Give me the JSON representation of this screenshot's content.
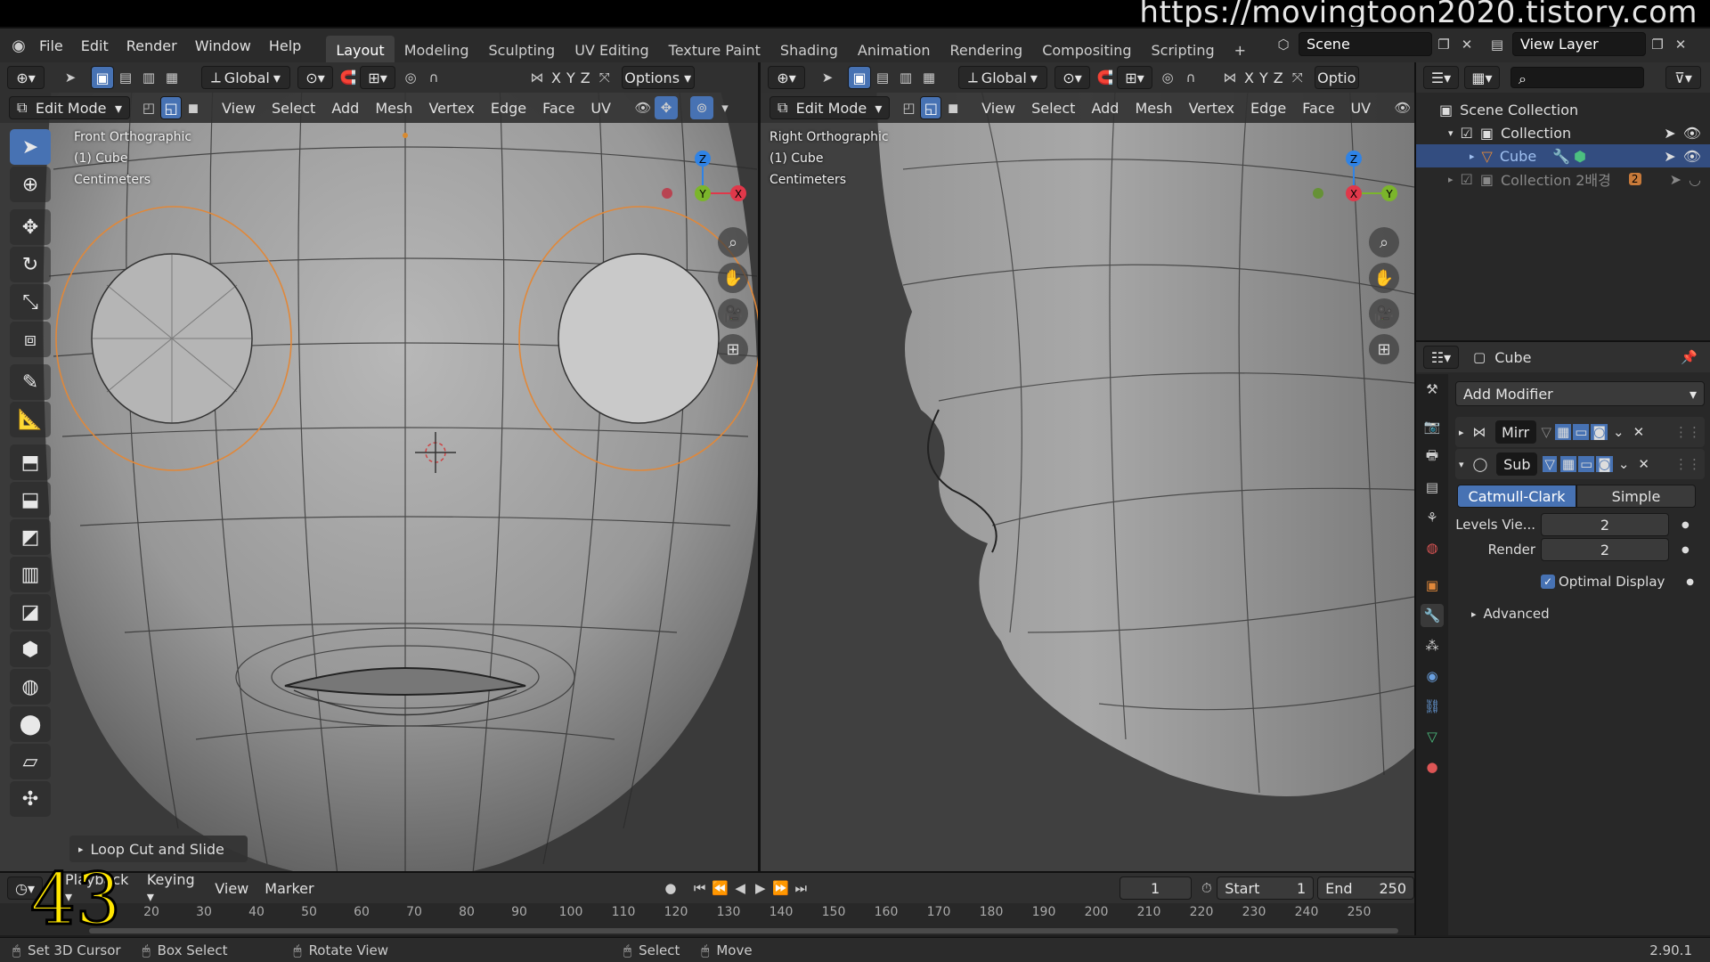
{
  "watermark": "https://movingtoon2020.tistory.com",
  "menu": [
    "File",
    "Edit",
    "Render",
    "Window",
    "Help"
  ],
  "workspaces": [
    "Layout",
    "Modeling",
    "Sculpting",
    "UV Editing",
    "Texture Paint",
    "Shading",
    "Animation",
    "Rendering",
    "Compositing",
    "Scripting"
  ],
  "scene": "Scene",
  "view_layer": "View Layer",
  "left_vp": {
    "orientation": "Global",
    "options": "Options",
    "mode": "Edit Mode",
    "menus": [
      "View",
      "Select",
      "Add",
      "Mesh",
      "Vertex",
      "Edge",
      "Face",
      "UV"
    ],
    "info": [
      "Front Orthographic",
      "(1) Cube",
      "Centimeters"
    ],
    "axes": [
      "Z",
      "Y",
      "X"
    ],
    "operator": "Loop Cut and Slide"
  },
  "right_vp": {
    "orientation": "Global",
    "options": "Optio",
    "mode": "Edit Mode",
    "menus": [
      "View",
      "Select",
      "Add",
      "Mesh",
      "Vertex",
      "Edge",
      "Face",
      "UV"
    ],
    "info": [
      "Right Orthographic",
      "(1) Cube",
      "Centimeters"
    ],
    "axes": [
      "Z",
      "X",
      "Y"
    ]
  },
  "axis_toggles": [
    "X",
    "Y",
    "Z"
  ],
  "outliner": {
    "root": "Scene Collection",
    "items": [
      "Collection",
      "Cube",
      "Collection 2배경"
    ],
    "badge": "2"
  },
  "properties": {
    "object": "Cube",
    "add_modifier": "Add Modifier",
    "modifiers": [
      "Mirr",
      "Sub"
    ],
    "subdiv_types": [
      "Catmull-Clark",
      "Simple"
    ],
    "levels_label": "Levels Vie...",
    "levels_value": "2",
    "render_label": "Render",
    "render_value": "2",
    "optimal_display": "Optimal Display",
    "advanced": "Advanced"
  },
  "timeline": {
    "playback": "Playback",
    "keying": "Keying",
    "menus": [
      "View",
      "Marker"
    ],
    "current_frame": "1",
    "start_label": "Start",
    "start": "1",
    "end_label": "End",
    "end": "250",
    "ticks": [
      "20",
      "30",
      "40",
      "50",
      "60",
      "70",
      "80",
      "90",
      "100",
      "110",
      "120",
      "130",
      "140",
      "150",
      "160",
      "170",
      "180",
      "190",
      "200",
      "210",
      "220",
      "230",
      "240",
      "250"
    ],
    "overlay_number": "43"
  },
  "status": {
    "items": [
      "Set 3D Cursor",
      "Box Select",
      "Rotate View",
      "Select",
      "Move"
    ],
    "version": "2.90.1"
  },
  "colors": {
    "accent": "#4772b3",
    "x_axis": "#e0384a",
    "y_axis": "#7bb52b",
    "z_axis": "#2f83e6",
    "selection": "#e0883a"
  }
}
